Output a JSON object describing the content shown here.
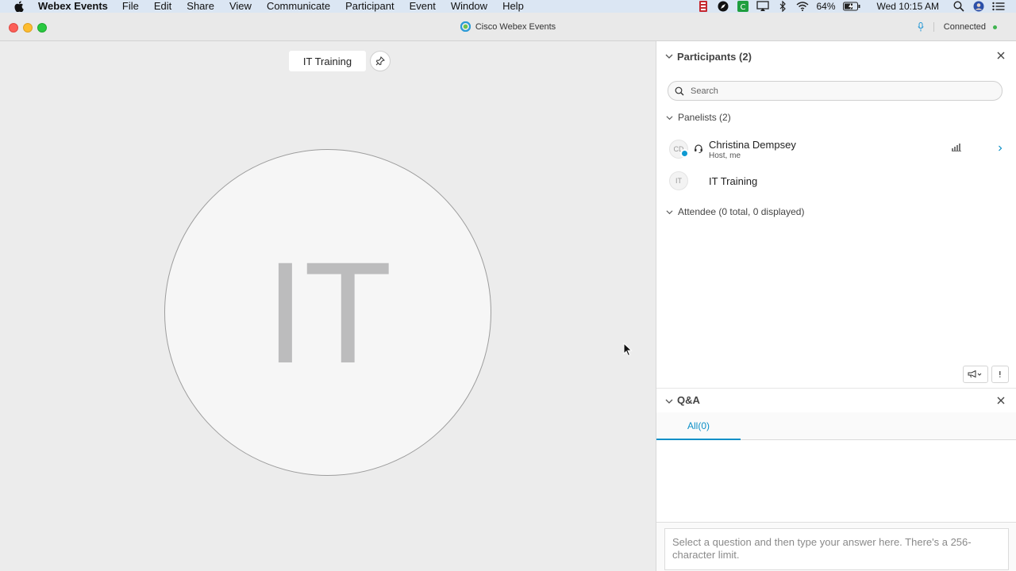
{
  "menubar": {
    "app_name": "Webex Events",
    "items": [
      "File",
      "Edit",
      "Share",
      "View",
      "Communicate",
      "Participant",
      "Event",
      "Window",
      "Help"
    ],
    "battery": "64%",
    "clock": "Wed 10:15 AM"
  },
  "window": {
    "title": "Cisco Webex Events",
    "status": "Connected",
    "status_color": "#3fb34f"
  },
  "stage": {
    "name_label": "IT Training",
    "avatar_initials": "IT"
  },
  "participants": {
    "title": "Participants (2)",
    "search_placeholder": "Search",
    "panelists_label": "Panelists (2)",
    "attendee_label": "Attendee (0 total, 0 displayed)",
    "panelists": [
      {
        "initials": "CD",
        "name": "Christina Dempsey",
        "role": "Host, me"
      },
      {
        "initials": "IT",
        "name": "IT Training",
        "role": ""
      }
    ]
  },
  "qa": {
    "title": "Q&A",
    "tabs": [
      {
        "label": "All(0)",
        "active": true
      }
    ],
    "answer_placeholder": "Select a question and then type your answer here. There's a 256-character limit."
  },
  "colors": {
    "accent": "#0b8fc7",
    "menubar_bg": "#dbe6f3",
    "stage_bg": "#ececec"
  }
}
